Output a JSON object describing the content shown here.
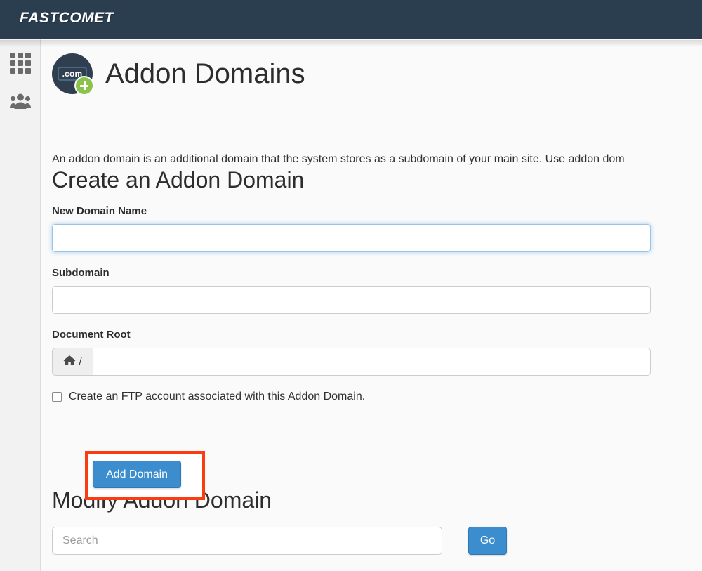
{
  "header": {
    "brand": "FASTCOMET"
  },
  "sidebar": {
    "items": [
      {
        "name": "apps-grid",
        "icon": "grid-icon"
      },
      {
        "name": "users",
        "icon": "users-icon"
      }
    ]
  },
  "page": {
    "title": "Addon Domains",
    "icon": "domain-plus-icon",
    "icon_tag_text": ".com",
    "intro": "An addon domain is an additional domain that the system stores as a subdomain of your main site. Use addon dom"
  },
  "create_section": {
    "heading": "Create an Addon Domain",
    "fields": [
      {
        "label": "New Domain Name",
        "value": "",
        "placeholder": "",
        "focused": true
      },
      {
        "label": "Subdomain",
        "value": "",
        "placeholder": "",
        "focused": false
      },
      {
        "label": "Document Root",
        "value": "",
        "placeholder": "",
        "prefix": "/",
        "prefix_icon": "home-icon",
        "focused": false
      }
    ],
    "checkbox": {
      "label": "Create an FTP account associated with this Addon Domain.",
      "checked": false
    },
    "submit_label": "Add Domain"
  },
  "modify_section": {
    "heading": "Modify Addon Domain",
    "search_placeholder": "Search",
    "search_value": "",
    "go_label": "Go"
  },
  "colors": {
    "header_bg": "#2b3e50",
    "primary_button": "#3c8dcd",
    "annotation_outline": "#fa3c10",
    "icon_green": "#8bc34a",
    "icon_navy": "#2f3f50",
    "focus_border": "#9dc3e6"
  }
}
